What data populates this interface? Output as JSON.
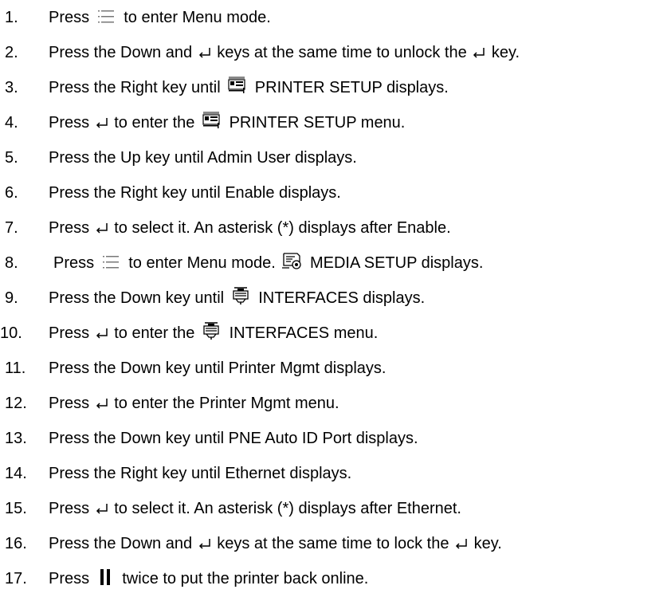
{
  "steps": [
    {
      "num": "1.",
      "parts": [
        "Press",
        "to enter Menu mode."
      ]
    },
    {
      "num": "2.",
      "parts": [
        "Press the Down and",
        "keys at the same time to unlock the",
        "key."
      ]
    },
    {
      "num": "3.",
      "parts": [
        "Press the Right key until",
        "PRINTER SETUP displays."
      ]
    },
    {
      "num": "4.",
      "parts": [
        "Press",
        "to enter the",
        "PRINTER SETUP menu."
      ]
    },
    {
      "num": "5.",
      "parts": [
        "Press the Up key until Admin User displays."
      ]
    },
    {
      "num": "6.",
      "parts": [
        "Press the Right key until Enable displays."
      ]
    },
    {
      "num": "7.",
      "parts": [
        "Press",
        "to select it. An asterisk (*) displays after Enable."
      ]
    },
    {
      "num": "8.",
      "parts": [
        "Press",
        "to enter Menu mode.",
        "MEDIA SETUP displays."
      ]
    },
    {
      "num": "9.",
      "parts": [
        "Press the Down key until",
        "INTERFACES displays."
      ]
    },
    {
      "num": "10.",
      "parts": [
        "Press",
        "to enter the",
        "INTERFACES menu."
      ]
    },
    {
      "num": "11.",
      "parts": [
        "Press the Down key until Printer Mgmt displays."
      ]
    },
    {
      "num": "12.",
      "parts": [
        "Press",
        "to enter the Printer Mgmt menu."
      ]
    },
    {
      "num": "13.",
      "parts": [
        "Press the Down key until PNE Auto ID Port displays."
      ]
    },
    {
      "num": "14.",
      "parts": [
        "Press the Right key until Ethernet displays."
      ]
    },
    {
      "num": "15.",
      "parts": [
        "Press",
        "to select it. An asterisk (*) displays after Ethernet."
      ]
    },
    {
      "num": "16.",
      "parts": [
        "Press the Down and",
        "keys at the same time to lock the",
        "key."
      ]
    },
    {
      "num": "17.",
      "parts": [
        "Press",
        "twice to put the printer back online."
      ]
    }
  ],
  "icons": {
    "menu": "menu-icon",
    "enter": "enter-key-icon",
    "printer_setup": "printer-setup-icon",
    "media_setup": "media-setup-icon",
    "interfaces": "interfaces-icon",
    "pause": "pause-icon"
  }
}
